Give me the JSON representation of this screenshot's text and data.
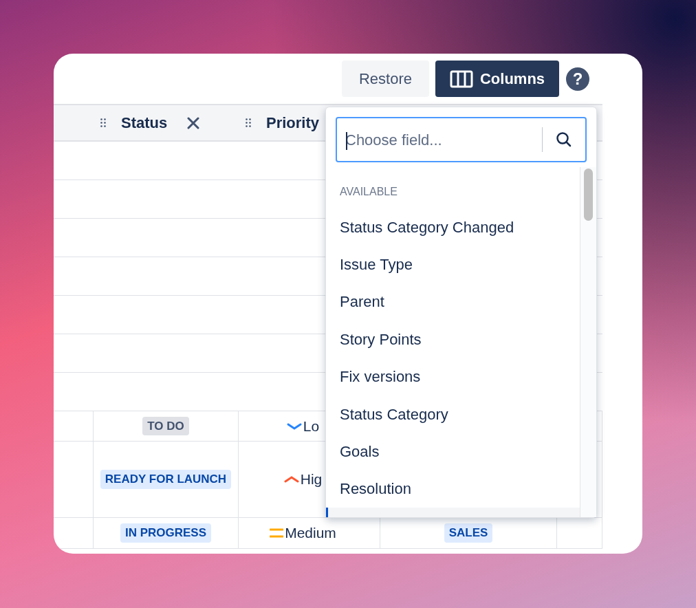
{
  "toolbar": {
    "buttons": [
      {
        "label": "Restore",
        "kind": "subtle"
      },
      {
        "label": "Columns",
        "kind": "primary"
      }
    ],
    "help": "?"
  },
  "table": {
    "columns": [
      {
        "label": "Status",
        "removable": true
      },
      {
        "label": "Priority",
        "removable": false
      }
    ],
    "rows": [
      {
        "status": {
          "label": "TO DO",
          "kind": "neutral"
        },
        "priority": {
          "label": "Lo",
          "kind": "low"
        }
      },
      {
        "status": {
          "label": "READY FOR LAUNCH",
          "kind": "info"
        },
        "priority": {
          "label": "Hig",
          "kind": "high"
        }
      },
      {
        "status": {
          "label": "IN PROGRESS",
          "kind": "info"
        },
        "priority": {
          "label": "Medium",
          "kind": "medium"
        },
        "column_4": {
          "label": "SALES",
          "kind": "info"
        }
      }
    ]
  },
  "dropdown": {
    "search": {
      "placeholder": "Choose field...",
      "focused": true
    },
    "section": "AVAILABLE",
    "items": [
      "Status Category Changed",
      "Issue Type",
      "Parent",
      "Story Points",
      "Fix versions",
      "Status Category",
      "Goals",
      "Resolution"
    ]
  }
}
